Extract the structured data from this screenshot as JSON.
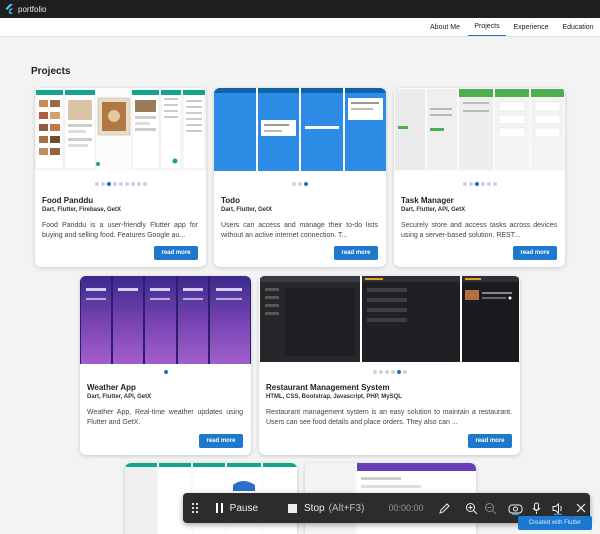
{
  "window": {
    "title": "portfolio"
  },
  "nav": {
    "items": [
      "About Me",
      "Projects",
      "Experience",
      "Education"
    ],
    "active": "Projects"
  },
  "section": {
    "title": "Projects"
  },
  "projects": [
    {
      "title": "Food Panddu",
      "tech": "Dart, Flutter, Firebase, GetX",
      "description": "Food Panddu is a user-friendly Flutter app for buying and selling food. Features Google au...",
      "button": "read more"
    },
    {
      "title": "Todo",
      "tech": "Dart, Flutter, GetX",
      "description": "Users can access and manage their to-do lists without an active internet connection. T...",
      "button": "read more"
    },
    {
      "title": "Task Manager",
      "tech": "Dart, Flutter, API, GetX",
      "description": "Securely store and access tasks across devices using a server-based solution. REST...",
      "button": "read more"
    },
    {
      "title": "Weather App",
      "tech": "Dart, Flutter, API, GetX",
      "description": "Weather App, Real-time weather updates using Flutter and GetX.",
      "button": "read more"
    },
    {
      "title": "Restaurant Management System",
      "tech": "HTML, CSS, Bootstrap, Javascript, PHP, MySQL",
      "description": "Restaurant management system is an easy solution to maintain a restaurant. Users can see food details and place orders. They also can ...",
      "button": "read more"
    }
  ],
  "recorder": {
    "pause": "Pause",
    "stop": "Stop",
    "shortcut": "(Alt+F3)",
    "time": "00:00:00"
  },
  "footer_badge": "Created with Flutter",
  "colors": {
    "accent": "#1e78cc",
    "titlebar": "#1e1e1e",
    "recorder": "#2c2c2e"
  }
}
